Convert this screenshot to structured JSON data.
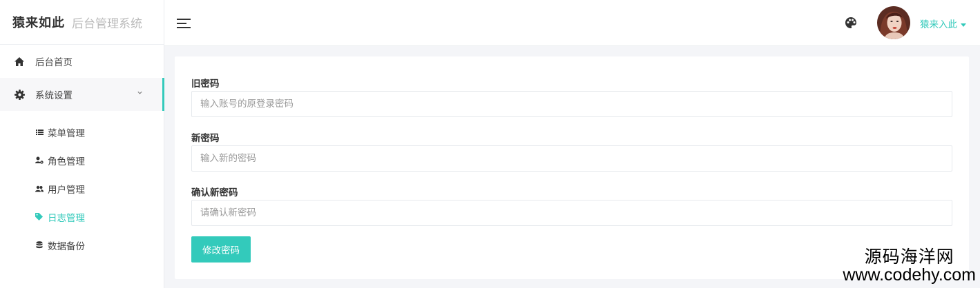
{
  "brand": {
    "logo_text": "猿来如此",
    "subtitle": "后台管理系统"
  },
  "sidebar": {
    "items": [
      {
        "label": "后台首页",
        "icon": "home-icon"
      },
      {
        "label": "系统设置",
        "icon": "gear-icon",
        "expanded": true
      }
    ],
    "submenu": [
      {
        "label": "菜单管理",
        "icon": "list-icon"
      },
      {
        "label": "角色管理",
        "icon": "user-settings-icon"
      },
      {
        "label": "用户管理",
        "icon": "users-icon"
      },
      {
        "label": "日志管理",
        "icon": "tag-icon",
        "active": true
      },
      {
        "label": "数据备份",
        "icon": "database-icon"
      }
    ]
  },
  "header": {
    "username": "猿来入此"
  },
  "form": {
    "old_password": {
      "label": "旧密码",
      "placeholder": "输入账号的原登录密码"
    },
    "new_password": {
      "label": "新密码",
      "placeholder": "输入新的密码"
    },
    "confirm_password": {
      "label": "确认新密码",
      "placeholder": "请确认新密码"
    },
    "submit_label": "修改密码"
  },
  "watermark": {
    "name": "源码海洋网",
    "url": "www.codehy.com"
  },
  "colors": {
    "accent": "#33cabb",
    "background": "#f4f5f8"
  }
}
